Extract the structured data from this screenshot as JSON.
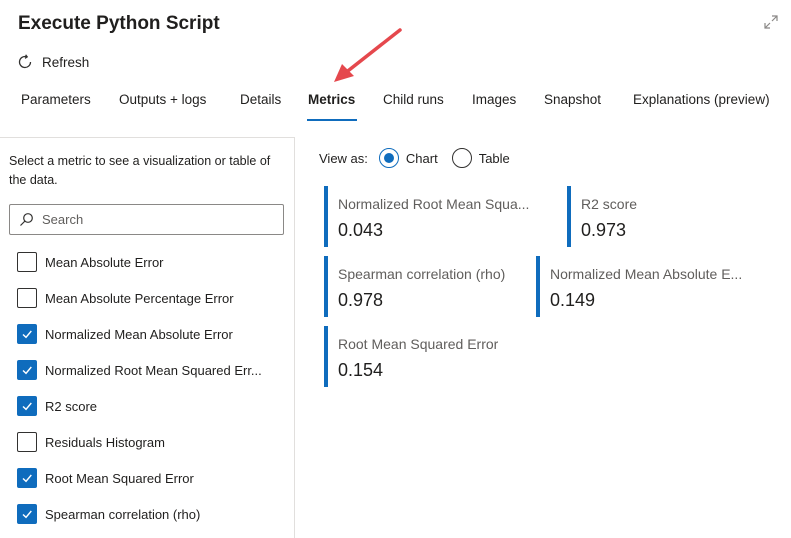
{
  "header": {
    "title": "Execute Python Script",
    "refresh_label": "Refresh"
  },
  "tabs": [
    {
      "label": "Parameters"
    },
    {
      "label": "Outputs + logs"
    },
    {
      "label": "Details"
    },
    {
      "label": "Metrics",
      "active": true
    },
    {
      "label": "Child runs"
    },
    {
      "label": "Images"
    },
    {
      "label": "Snapshot"
    },
    {
      "label": "Explanations (preview)"
    }
  ],
  "left_panel": {
    "description": "Select a metric to see a visualization or table of the data.",
    "search_placeholder": "Search",
    "metrics": [
      {
        "label": "Mean Absolute Error",
        "checked": false
      },
      {
        "label": "Mean Absolute Percentage Error",
        "checked": false
      },
      {
        "label": "Normalized Mean Absolute Error",
        "checked": true
      },
      {
        "label": "Normalized Root Mean Squared Err...",
        "checked": true
      },
      {
        "label": "R2 score",
        "checked": true
      },
      {
        "label": "Residuals Histogram",
        "checked": false
      },
      {
        "label": "Root Mean Squared Error",
        "checked": true
      },
      {
        "label": "Spearman correlation (rho)",
        "checked": true
      }
    ]
  },
  "view": {
    "label": "View as:",
    "options": [
      {
        "label": "Chart",
        "selected": true
      },
      {
        "label": "Table",
        "selected": false
      }
    ]
  },
  "cards": [
    {
      "name": "Normalized Root Mean Squa...",
      "value": "0.043"
    },
    {
      "name": "R2 score",
      "value": "0.973"
    },
    {
      "name": "Spearman correlation (rho)",
      "value": "0.978"
    },
    {
      "name": "Normalized Mean Absolute E...",
      "value": "0.149"
    },
    {
      "name": "Root Mean Squared Error",
      "value": "0.154"
    }
  ],
  "colors": {
    "accent": "#0f6cbd",
    "annotation_arrow": "#e5484d"
  }
}
